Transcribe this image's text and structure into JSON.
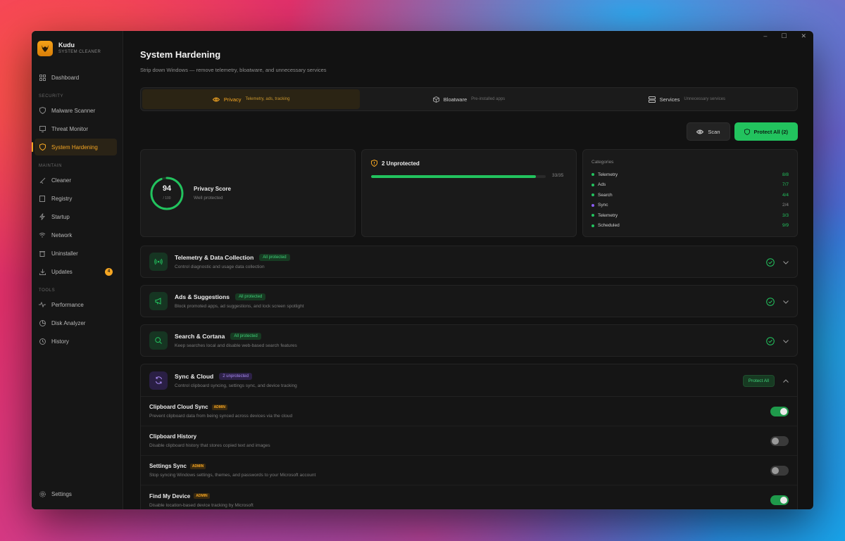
{
  "app": {
    "name": "Kudu",
    "subtitle": "SYSTEM CLEANER"
  },
  "window_controls": {
    "minimize": "–",
    "maximize": "☐",
    "close": "✕"
  },
  "sidebar": {
    "dashboard": "Dashboard",
    "security_label": "SECURITY",
    "security": [
      "Malware Scanner",
      "Threat Monitor",
      "System Hardening"
    ],
    "maintain_label": "MAINTAIN",
    "maintain": [
      "Cleaner",
      "Registry",
      "Startup",
      "Network",
      "Uninstaller",
      "Updates"
    ],
    "updates_badge": "4",
    "tools_label": "TOOLS",
    "tools": [
      "Performance",
      "Disk Analyzer",
      "History"
    ],
    "settings": "Settings",
    "active": "System Hardening"
  },
  "page": {
    "title": "System Hardening",
    "subtitle": "Strip down Windows — remove telemetry, bloatware, and unnecessary services"
  },
  "tabs": [
    {
      "label": "Privacy",
      "desc": "Telemetry, ads, tracking",
      "active": true
    },
    {
      "label": "Bloatware",
      "desc": "Pre-installed apps",
      "active": false
    },
    {
      "label": "Services",
      "desc": "Unnecessary services",
      "active": false
    }
  ],
  "actions": {
    "scan": "Scan",
    "protect_all": "Protect All (2)"
  },
  "score": {
    "value": "94",
    "max": "/ 100",
    "label": "Privacy Score",
    "status": "Well protected",
    "fraction": 0.94
  },
  "unprotected": {
    "title": "2 Unprotected",
    "count": "33/35",
    "fraction": 0.943
  },
  "categories": {
    "title": "Categories",
    "items": [
      {
        "name": "Telemetry",
        "value": "8/8",
        "full": true
      },
      {
        "name": "Ads",
        "value": "7/7",
        "full": true
      },
      {
        "name": "Search",
        "value": "4/4",
        "full": true
      },
      {
        "name": "Sync",
        "value": "2/4",
        "full": false
      },
      {
        "name": "Telemetry",
        "value": "3/3",
        "full": true
      },
      {
        "name": "Scheduled",
        "value": "9/9",
        "full": true
      }
    ]
  },
  "sections": [
    {
      "title": "Telemetry & Data Collection",
      "tag": "All protected",
      "desc": "Control diagnostic and usage data collection"
    },
    {
      "title": "Ads & Suggestions",
      "tag": "All protected",
      "desc": "Block promoted apps, ad suggestions, and lock screen spotlight"
    },
    {
      "title": "Search & Cortana",
      "tag": "All protected",
      "desc": "Keep searches local and disable web-based search features"
    }
  ],
  "sync": {
    "title": "Sync & Cloud",
    "tag": "2 unprotected",
    "desc": "Control clipboard syncing, settings sync, and device tracking",
    "protect_all": "Protect All",
    "admin_label": "ADMIN",
    "items": [
      {
        "title": "Clipboard Cloud Sync",
        "desc": "Prevent clipboard data from being synced across devices via the cloud",
        "admin": true,
        "on": true
      },
      {
        "title": "Clipboard History",
        "desc": "Disable clipboard history that stores copied text and images",
        "admin": false,
        "on": false
      },
      {
        "title": "Settings Sync",
        "desc": "Stop syncing Windows settings, themes, and passwords to your Microsoft account",
        "admin": true,
        "on": false
      },
      {
        "title": "Find My Device",
        "desc": "Disable location-based device tracking by Microsoft",
        "admin": true,
        "on": true
      }
    ]
  },
  "colors": {
    "accent": "#f5a623",
    "green": "#22c35e",
    "purple": "#8b5cf6",
    "bg": "#121212"
  }
}
